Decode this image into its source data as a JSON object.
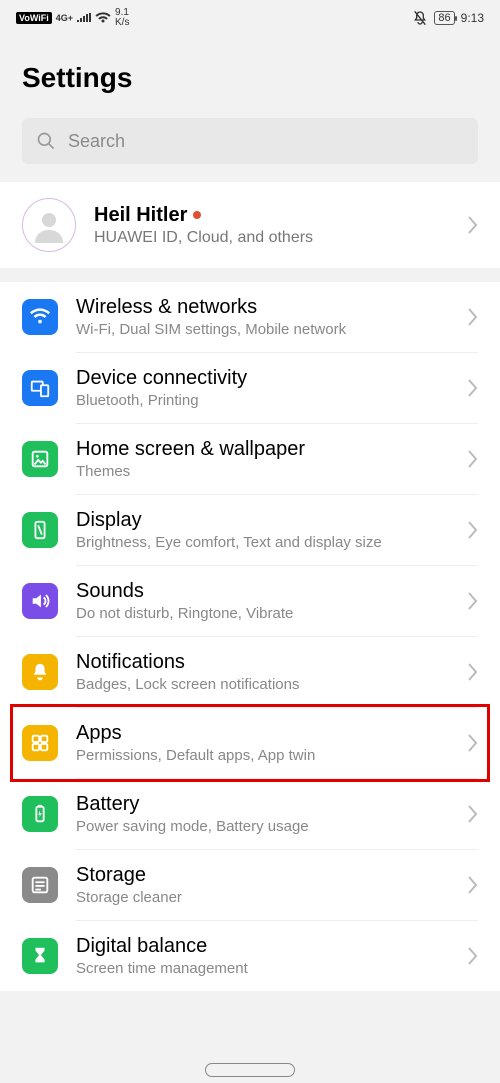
{
  "status": {
    "vowifi": "VoWiFi",
    "net_label": "4G+",
    "speed": "9.1",
    "speed_unit": "K/s",
    "battery": "86",
    "time": "9:13"
  },
  "page_title": "Settings",
  "search": {
    "placeholder": "Search"
  },
  "profile": {
    "name": "Heil Hitler",
    "sub": "HUAWEI ID, Cloud, and others"
  },
  "items": [
    {
      "title": "Wireless & networks",
      "sub": "Wi-Fi, Dual SIM settings, Mobile network"
    },
    {
      "title": "Device connectivity",
      "sub": "Bluetooth, Printing"
    },
    {
      "title": "Home screen & wallpaper",
      "sub": "Themes"
    },
    {
      "title": "Display",
      "sub": "Brightness, Eye comfort, Text and display size"
    },
    {
      "title": "Sounds",
      "sub": "Do not disturb, Ringtone, Vibrate"
    },
    {
      "title": "Notifications",
      "sub": "Badges, Lock screen notifications"
    },
    {
      "title": "Apps",
      "sub": "Permissions, Default apps, App twin"
    },
    {
      "title": "Battery",
      "sub": "Power saving mode, Battery usage"
    },
    {
      "title": "Storage",
      "sub": "Storage cleaner"
    },
    {
      "title": "Digital balance",
      "sub": "Screen time management"
    }
  ]
}
